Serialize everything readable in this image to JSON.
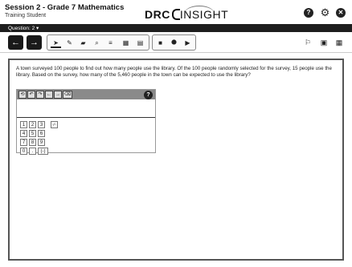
{
  "header": {
    "session_title": "Session 2 - Grade 7 Mathematics",
    "student_name": "Training Student",
    "brand_prefix": "DRC",
    "brand_suffix": "INSIGHT",
    "help_glyph": "?",
    "settings_glyph": "⚙",
    "close_glyph": "✕"
  },
  "question_bar": {
    "label": "Question: 2 ▾"
  },
  "toolbar": {
    "back_glyph": "←",
    "next_glyph": "→",
    "tools": [
      {
        "name": "pointer-icon",
        "glyph": "➤"
      },
      {
        "name": "pencil-icon",
        "glyph": "✎"
      },
      {
        "name": "highlighter-icon",
        "glyph": "▰"
      },
      {
        "name": "magnifier-icon",
        "glyph": "⌕"
      },
      {
        "name": "line-reader-icon",
        "glyph": "≡"
      },
      {
        "name": "answer-masking-icon",
        "glyph": "▦"
      },
      {
        "name": "notepad-icon",
        "glyph": "▤"
      }
    ],
    "media_tools": [
      {
        "name": "stop-icon",
        "glyph": "■"
      },
      {
        "name": "location-pin-icon",
        "glyph": "⬤"
      },
      {
        "name": "play-icon",
        "glyph": "▶"
      }
    ],
    "right_tools": [
      {
        "name": "flag-icon",
        "glyph": "⚐"
      },
      {
        "name": "review-icon",
        "glyph": "▣"
      },
      {
        "name": "calculator-icon",
        "glyph": "▦"
      }
    ]
  },
  "question": {
    "prompt": "A town surveyed 100 people to find out how many people use the library. Of the 100 people randomly selected for the survey, 15 people use the library. Based on the survey, how many of the 5,460 people in the town can be expected to use the library?"
  },
  "equation_editor": {
    "buttons": [
      "⟲",
      "↶",
      "↷",
      "←",
      "→",
      "⌫"
    ],
    "help_glyph": "?",
    "keypad_rows": [
      [
        "1",
        "2",
        "3"
      ],
      [
        "4",
        "5",
        "6"
      ],
      [
        "7",
        "8",
        "9"
      ],
      [
        "0",
        ".",
        "(-)"
      ]
    ],
    "fraction_key": "▫⁄▫"
  }
}
